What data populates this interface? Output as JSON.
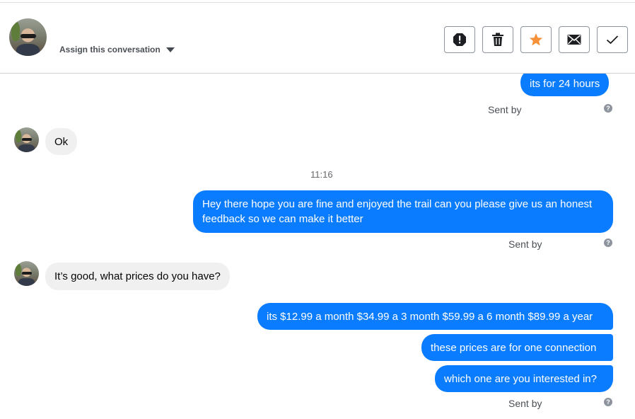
{
  "header": {
    "assign_label": "Assign this conversation",
    "buttons": [
      {
        "name": "spam",
        "icon": "exclamation-icon"
      },
      {
        "name": "delete",
        "icon": "trash-icon"
      },
      {
        "name": "star",
        "icon": "star-icon",
        "color": "#f7923b"
      },
      {
        "name": "mark-unread",
        "icon": "envelope-icon"
      },
      {
        "name": "done",
        "icon": "check-icon"
      }
    ]
  },
  "colors": {
    "accent": "#0a7cff",
    "incoming_bg": "#f0f0f0",
    "star": "#f7923b"
  },
  "messages": {
    "m1": "its for 24 hours",
    "sent1": "Sent by",
    "m2": "Ok",
    "timestamp": "11:16",
    "m3": "Hey there hope you are fine and enjoyed the trail can you please give us an honest feedback so we can make it better",
    "sent2": "Sent by",
    "m4": "It’s good, what prices do you have?",
    "m5": "its $12.99 a month $34.99 a 3 month $59.99 a 6 month $89.99 a year",
    "m6": "these prices are for one connection",
    "m7": "which one are you interested in?",
    "sent3": "Sent by",
    "help_glyph": "?"
  }
}
